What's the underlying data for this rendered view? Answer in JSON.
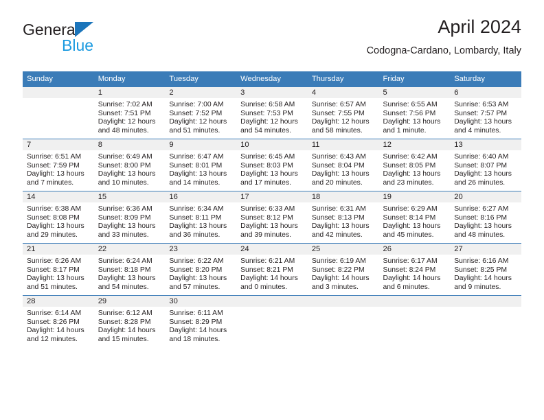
{
  "brand": {
    "name_part1": "General",
    "name_part2": "Blue",
    "triangle_color": "#1b75bb",
    "blue_color": "#1b9ae0"
  },
  "header": {
    "title": "April 2024",
    "subtitle": "Codogna-Cardano, Lombardy, Italy"
  },
  "theme": {
    "header_bg": "#3b7cb8",
    "daynum_band_bg": "#f0f0f0",
    "text_color": "#231f20"
  },
  "weekday_headers": [
    "Sunday",
    "Monday",
    "Tuesday",
    "Wednesday",
    "Thursday",
    "Friday",
    "Saturday"
  ],
  "weeks": [
    [
      {
        "day": "",
        "sunrise": "",
        "sunset": "",
        "daylight1": "",
        "daylight2": ""
      },
      {
        "day": "1",
        "sunrise": "Sunrise: 7:02 AM",
        "sunset": "Sunset: 7:51 PM",
        "daylight1": "Daylight: 12 hours",
        "daylight2": "and 48 minutes."
      },
      {
        "day": "2",
        "sunrise": "Sunrise: 7:00 AM",
        "sunset": "Sunset: 7:52 PM",
        "daylight1": "Daylight: 12 hours",
        "daylight2": "and 51 minutes."
      },
      {
        "day": "3",
        "sunrise": "Sunrise: 6:58 AM",
        "sunset": "Sunset: 7:53 PM",
        "daylight1": "Daylight: 12 hours",
        "daylight2": "and 54 minutes."
      },
      {
        "day": "4",
        "sunrise": "Sunrise: 6:57 AM",
        "sunset": "Sunset: 7:55 PM",
        "daylight1": "Daylight: 12 hours",
        "daylight2": "and 58 minutes."
      },
      {
        "day": "5",
        "sunrise": "Sunrise: 6:55 AM",
        "sunset": "Sunset: 7:56 PM",
        "daylight1": "Daylight: 13 hours",
        "daylight2": "and 1 minute."
      },
      {
        "day": "6",
        "sunrise": "Sunrise: 6:53 AM",
        "sunset": "Sunset: 7:57 PM",
        "daylight1": "Daylight: 13 hours",
        "daylight2": "and 4 minutes."
      }
    ],
    [
      {
        "day": "7",
        "sunrise": "Sunrise: 6:51 AM",
        "sunset": "Sunset: 7:59 PM",
        "daylight1": "Daylight: 13 hours",
        "daylight2": "and 7 minutes."
      },
      {
        "day": "8",
        "sunrise": "Sunrise: 6:49 AM",
        "sunset": "Sunset: 8:00 PM",
        "daylight1": "Daylight: 13 hours",
        "daylight2": "and 10 minutes."
      },
      {
        "day": "9",
        "sunrise": "Sunrise: 6:47 AM",
        "sunset": "Sunset: 8:01 PM",
        "daylight1": "Daylight: 13 hours",
        "daylight2": "and 14 minutes."
      },
      {
        "day": "10",
        "sunrise": "Sunrise: 6:45 AM",
        "sunset": "Sunset: 8:03 PM",
        "daylight1": "Daylight: 13 hours",
        "daylight2": "and 17 minutes."
      },
      {
        "day": "11",
        "sunrise": "Sunrise: 6:43 AM",
        "sunset": "Sunset: 8:04 PM",
        "daylight1": "Daylight: 13 hours",
        "daylight2": "and 20 minutes."
      },
      {
        "day": "12",
        "sunrise": "Sunrise: 6:42 AM",
        "sunset": "Sunset: 8:05 PM",
        "daylight1": "Daylight: 13 hours",
        "daylight2": "and 23 minutes."
      },
      {
        "day": "13",
        "sunrise": "Sunrise: 6:40 AM",
        "sunset": "Sunset: 8:07 PM",
        "daylight1": "Daylight: 13 hours",
        "daylight2": "and 26 minutes."
      }
    ],
    [
      {
        "day": "14",
        "sunrise": "Sunrise: 6:38 AM",
        "sunset": "Sunset: 8:08 PM",
        "daylight1": "Daylight: 13 hours",
        "daylight2": "and 29 minutes."
      },
      {
        "day": "15",
        "sunrise": "Sunrise: 6:36 AM",
        "sunset": "Sunset: 8:09 PM",
        "daylight1": "Daylight: 13 hours",
        "daylight2": "and 33 minutes."
      },
      {
        "day": "16",
        "sunrise": "Sunrise: 6:34 AM",
        "sunset": "Sunset: 8:11 PM",
        "daylight1": "Daylight: 13 hours",
        "daylight2": "and 36 minutes."
      },
      {
        "day": "17",
        "sunrise": "Sunrise: 6:33 AM",
        "sunset": "Sunset: 8:12 PM",
        "daylight1": "Daylight: 13 hours",
        "daylight2": "and 39 minutes."
      },
      {
        "day": "18",
        "sunrise": "Sunrise: 6:31 AM",
        "sunset": "Sunset: 8:13 PM",
        "daylight1": "Daylight: 13 hours",
        "daylight2": "and 42 minutes."
      },
      {
        "day": "19",
        "sunrise": "Sunrise: 6:29 AM",
        "sunset": "Sunset: 8:14 PM",
        "daylight1": "Daylight: 13 hours",
        "daylight2": "and 45 minutes."
      },
      {
        "day": "20",
        "sunrise": "Sunrise: 6:27 AM",
        "sunset": "Sunset: 8:16 PM",
        "daylight1": "Daylight: 13 hours",
        "daylight2": "and 48 minutes."
      }
    ],
    [
      {
        "day": "21",
        "sunrise": "Sunrise: 6:26 AM",
        "sunset": "Sunset: 8:17 PM",
        "daylight1": "Daylight: 13 hours",
        "daylight2": "and 51 minutes."
      },
      {
        "day": "22",
        "sunrise": "Sunrise: 6:24 AM",
        "sunset": "Sunset: 8:18 PM",
        "daylight1": "Daylight: 13 hours",
        "daylight2": "and 54 minutes."
      },
      {
        "day": "23",
        "sunrise": "Sunrise: 6:22 AM",
        "sunset": "Sunset: 8:20 PM",
        "daylight1": "Daylight: 13 hours",
        "daylight2": "and 57 minutes."
      },
      {
        "day": "24",
        "sunrise": "Sunrise: 6:21 AM",
        "sunset": "Sunset: 8:21 PM",
        "daylight1": "Daylight: 14 hours",
        "daylight2": "and 0 minutes."
      },
      {
        "day": "25",
        "sunrise": "Sunrise: 6:19 AM",
        "sunset": "Sunset: 8:22 PM",
        "daylight1": "Daylight: 14 hours",
        "daylight2": "and 3 minutes."
      },
      {
        "day": "26",
        "sunrise": "Sunrise: 6:17 AM",
        "sunset": "Sunset: 8:24 PM",
        "daylight1": "Daylight: 14 hours",
        "daylight2": "and 6 minutes."
      },
      {
        "day": "27",
        "sunrise": "Sunrise: 6:16 AM",
        "sunset": "Sunset: 8:25 PM",
        "daylight1": "Daylight: 14 hours",
        "daylight2": "and 9 minutes."
      }
    ],
    [
      {
        "day": "28",
        "sunrise": "Sunrise: 6:14 AM",
        "sunset": "Sunset: 8:26 PM",
        "daylight1": "Daylight: 14 hours",
        "daylight2": "and 12 minutes."
      },
      {
        "day": "29",
        "sunrise": "Sunrise: 6:12 AM",
        "sunset": "Sunset: 8:28 PM",
        "daylight1": "Daylight: 14 hours",
        "daylight2": "and 15 minutes."
      },
      {
        "day": "30",
        "sunrise": "Sunrise: 6:11 AM",
        "sunset": "Sunset: 8:29 PM",
        "daylight1": "Daylight: 14 hours",
        "daylight2": "and 18 minutes."
      },
      {
        "day": "",
        "sunrise": "",
        "sunset": "",
        "daylight1": "",
        "daylight2": ""
      },
      {
        "day": "",
        "sunrise": "",
        "sunset": "",
        "daylight1": "",
        "daylight2": ""
      },
      {
        "day": "",
        "sunrise": "",
        "sunset": "",
        "daylight1": "",
        "daylight2": ""
      },
      {
        "day": "",
        "sunrise": "",
        "sunset": "",
        "daylight1": "",
        "daylight2": ""
      }
    ]
  ]
}
